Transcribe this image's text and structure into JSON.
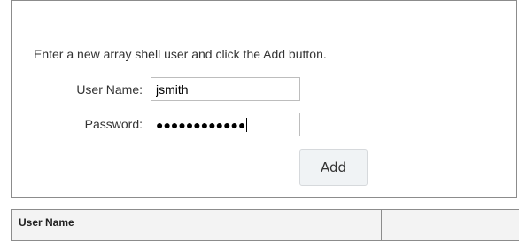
{
  "form": {
    "instructions": "Enter a new array shell user and click the Add button.",
    "user_name_label": "User Name:",
    "user_name_value": "jsmith",
    "password_label": "Password:",
    "password_masked": "●●●●●●●●●●●●",
    "add_button_label": "Add"
  },
  "users_table": {
    "columns": [
      "User Name",
      ""
    ]
  }
}
